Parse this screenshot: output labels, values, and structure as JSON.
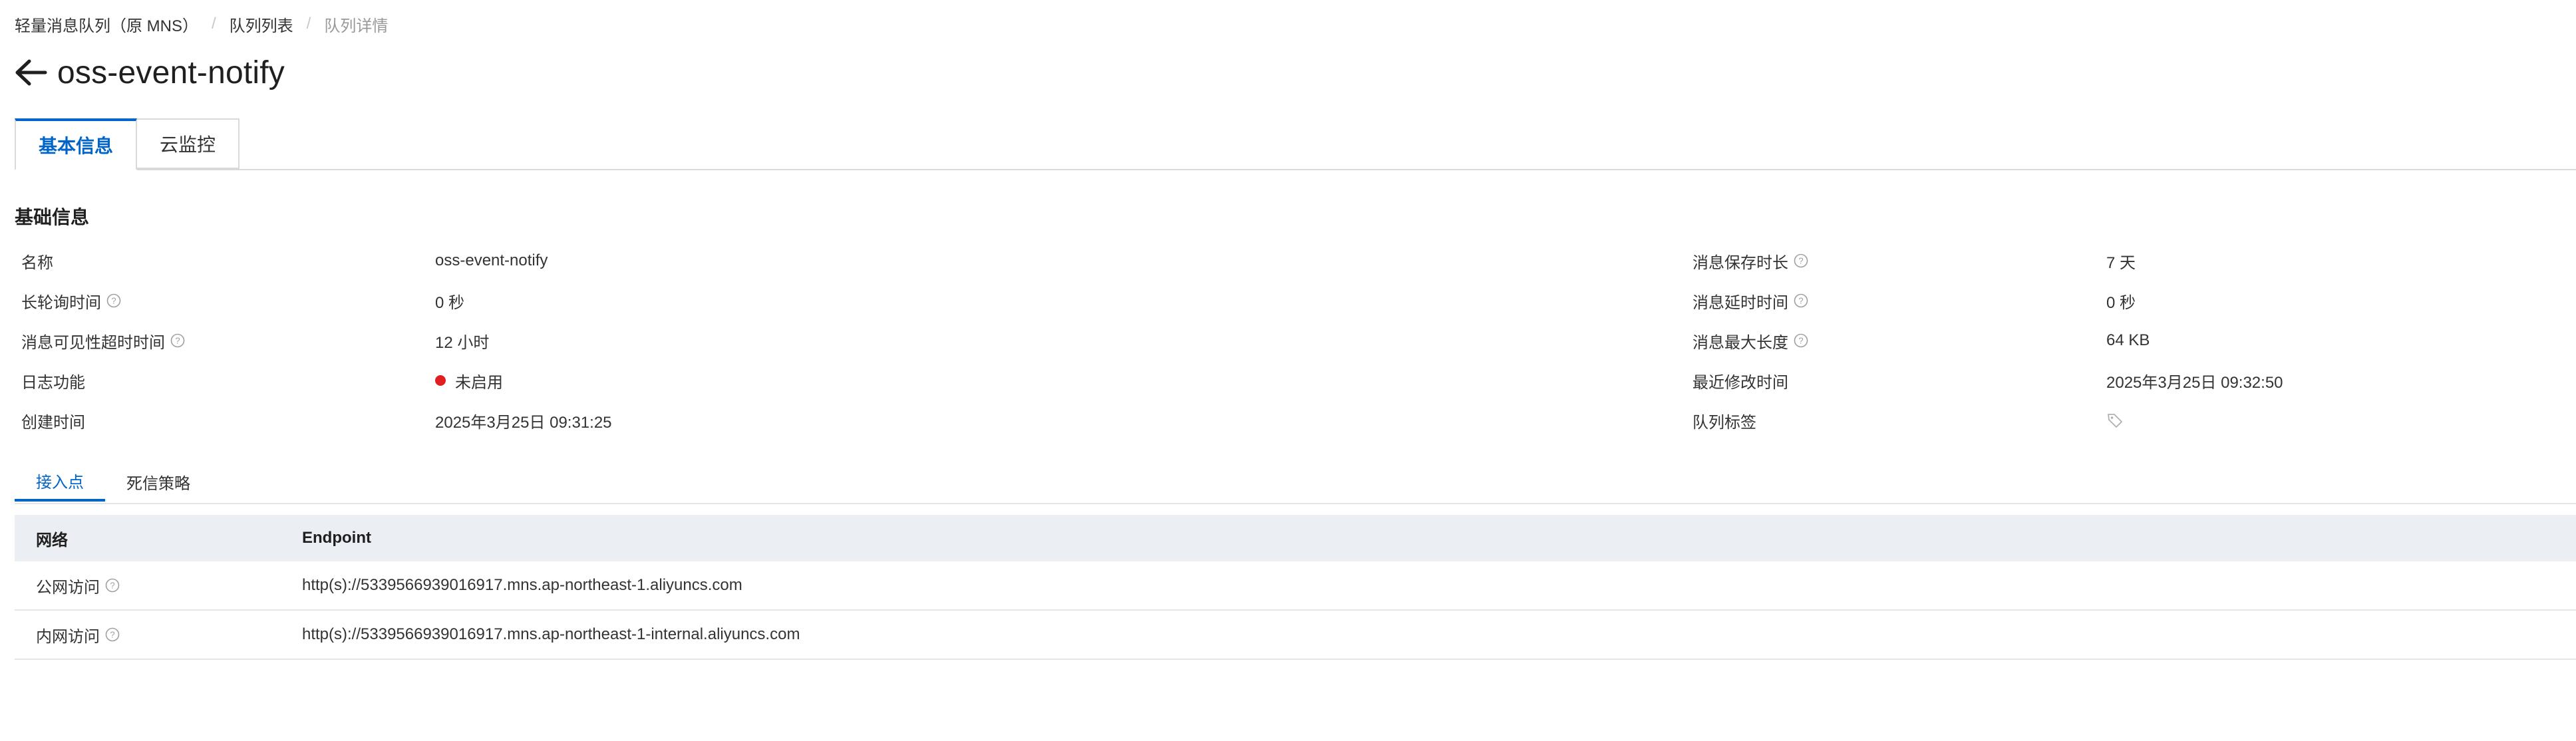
{
  "breadcrumb": {
    "items": [
      "轻量消息队列（原 MNS）",
      "队列列表",
      "队列详情"
    ],
    "separator": "/"
  },
  "page": {
    "title": "oss-event-notify"
  },
  "main_tabs": [
    {
      "label": "基本信息",
      "active": true
    },
    {
      "label": "云监控",
      "active": false
    }
  ],
  "section": {
    "title": "基础信息"
  },
  "info": {
    "left": [
      {
        "label": "名称",
        "value": "oss-event-notify",
        "help": false
      },
      {
        "label": "长轮询时间",
        "value": "0 秒",
        "help": true
      },
      {
        "label": "消息可见性超时时间",
        "value": "12 小时",
        "help": true
      },
      {
        "label": "日志功能",
        "value": "未启用",
        "help": false,
        "status_color": "#e02020"
      },
      {
        "label": "创建时间",
        "value": "2025年3月25日 09:31:25",
        "help": false
      }
    ],
    "right": [
      {
        "label": "消息保存时长",
        "value": "7 天",
        "help": true
      },
      {
        "label": "消息延时时间",
        "value": "0 秒",
        "help": true
      },
      {
        "label": "消息最大长度",
        "value": "64 KB",
        "help": true
      },
      {
        "label": "最近修改时间",
        "value": "2025年3月25日 09:32:50",
        "help": false
      },
      {
        "label": "队列标签",
        "value": "",
        "help": false,
        "icon": "tag-icon"
      }
    ]
  },
  "sub_tabs": [
    {
      "label": "接入点",
      "active": true
    },
    {
      "label": "死信策略",
      "active": false
    }
  ],
  "endpoint_table": {
    "headers": [
      "网络",
      "Endpoint"
    ],
    "rows": [
      {
        "network": "公网访问",
        "endpoint": "http(s)://5339566939016917.mns.ap-northeast-1.aliyuncs.com"
      },
      {
        "network": "内网访问",
        "endpoint": "http(s)://5339566939016917.mns.ap-northeast-1-internal.aliyuncs.com"
      }
    ]
  },
  "colors": {
    "accent": "#0064c8",
    "status_disabled": "#e02020",
    "table_header_bg": "#ebeef3"
  }
}
